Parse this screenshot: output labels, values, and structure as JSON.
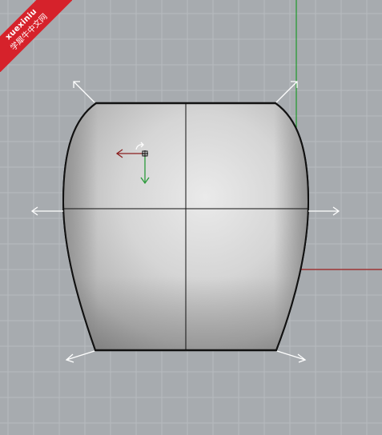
{
  "viewport": {
    "background_color": "#a7abaf",
    "grid_color": "#b7bbbf",
    "x_axis_color": "#9b1c1c",
    "y_axis_color": "#1e9a2a",
    "object": {
      "shape": "vase",
      "fill_highlight": "#e6e6e6",
      "fill_shadow": "#8b8b8b",
      "outline_color": "#111111"
    },
    "gumball": {
      "x_arrow_color": "#8a1f1f",
      "y_arrow_color": "#2a9a3a"
    }
  },
  "watermark": {
    "line1": "xuexiniu",
    "line2": "学犀牛中文网",
    "color": "#d6222b"
  }
}
